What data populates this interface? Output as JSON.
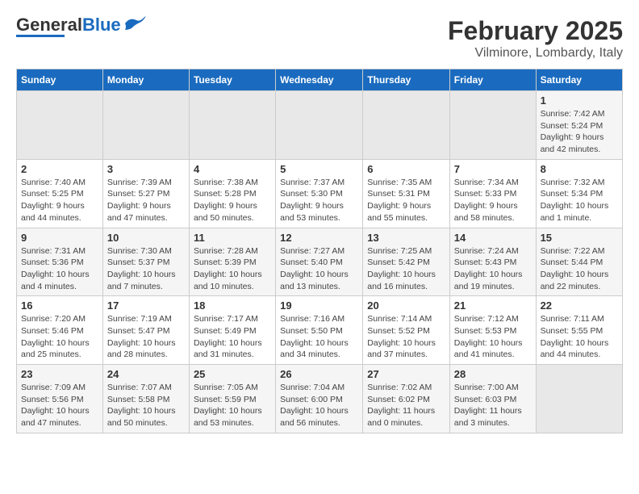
{
  "header": {
    "logo_general": "General",
    "logo_blue": "Blue",
    "title": "February 2025",
    "subtitle": "Vilminore, Lombardy, Italy"
  },
  "weekdays": [
    "Sunday",
    "Monday",
    "Tuesday",
    "Wednesday",
    "Thursday",
    "Friday",
    "Saturday"
  ],
  "weeks": [
    [
      {
        "day": "",
        "empty": true
      },
      {
        "day": "",
        "empty": true
      },
      {
        "day": "",
        "empty": true
      },
      {
        "day": "",
        "empty": true
      },
      {
        "day": "",
        "empty": true
      },
      {
        "day": "",
        "empty": true
      },
      {
        "day": "1",
        "sunrise": "Sunrise: 7:42 AM",
        "sunset": "Sunset: 5:24 PM",
        "daylight": "Daylight: 9 hours and 42 minutes."
      }
    ],
    [
      {
        "day": "2",
        "sunrise": "Sunrise: 7:40 AM",
        "sunset": "Sunset: 5:25 PM",
        "daylight": "Daylight: 9 hours and 44 minutes."
      },
      {
        "day": "3",
        "sunrise": "Sunrise: 7:39 AM",
        "sunset": "Sunset: 5:27 PM",
        "daylight": "Daylight: 9 hours and 47 minutes."
      },
      {
        "day": "4",
        "sunrise": "Sunrise: 7:38 AM",
        "sunset": "Sunset: 5:28 PM",
        "daylight": "Daylight: 9 hours and 50 minutes."
      },
      {
        "day": "5",
        "sunrise": "Sunrise: 7:37 AM",
        "sunset": "Sunset: 5:30 PM",
        "daylight": "Daylight: 9 hours and 53 minutes."
      },
      {
        "day": "6",
        "sunrise": "Sunrise: 7:35 AM",
        "sunset": "Sunset: 5:31 PM",
        "daylight": "Daylight: 9 hours and 55 minutes."
      },
      {
        "day": "7",
        "sunrise": "Sunrise: 7:34 AM",
        "sunset": "Sunset: 5:33 PM",
        "daylight": "Daylight: 9 hours and 58 minutes."
      },
      {
        "day": "8",
        "sunrise": "Sunrise: 7:32 AM",
        "sunset": "Sunset: 5:34 PM",
        "daylight": "Daylight: 10 hours and 1 minute."
      }
    ],
    [
      {
        "day": "9",
        "sunrise": "Sunrise: 7:31 AM",
        "sunset": "Sunset: 5:36 PM",
        "daylight": "Daylight: 10 hours and 4 minutes."
      },
      {
        "day": "10",
        "sunrise": "Sunrise: 7:30 AM",
        "sunset": "Sunset: 5:37 PM",
        "daylight": "Daylight: 10 hours and 7 minutes."
      },
      {
        "day": "11",
        "sunrise": "Sunrise: 7:28 AM",
        "sunset": "Sunset: 5:39 PM",
        "daylight": "Daylight: 10 hours and 10 minutes."
      },
      {
        "day": "12",
        "sunrise": "Sunrise: 7:27 AM",
        "sunset": "Sunset: 5:40 PM",
        "daylight": "Daylight: 10 hours and 13 minutes."
      },
      {
        "day": "13",
        "sunrise": "Sunrise: 7:25 AM",
        "sunset": "Sunset: 5:42 PM",
        "daylight": "Daylight: 10 hours and 16 minutes."
      },
      {
        "day": "14",
        "sunrise": "Sunrise: 7:24 AM",
        "sunset": "Sunset: 5:43 PM",
        "daylight": "Daylight: 10 hours and 19 minutes."
      },
      {
        "day": "15",
        "sunrise": "Sunrise: 7:22 AM",
        "sunset": "Sunset: 5:44 PM",
        "daylight": "Daylight: 10 hours and 22 minutes."
      }
    ],
    [
      {
        "day": "16",
        "sunrise": "Sunrise: 7:20 AM",
        "sunset": "Sunset: 5:46 PM",
        "daylight": "Daylight: 10 hours and 25 minutes."
      },
      {
        "day": "17",
        "sunrise": "Sunrise: 7:19 AM",
        "sunset": "Sunset: 5:47 PM",
        "daylight": "Daylight: 10 hours and 28 minutes."
      },
      {
        "day": "18",
        "sunrise": "Sunrise: 7:17 AM",
        "sunset": "Sunset: 5:49 PM",
        "daylight": "Daylight: 10 hours and 31 minutes."
      },
      {
        "day": "19",
        "sunrise": "Sunrise: 7:16 AM",
        "sunset": "Sunset: 5:50 PM",
        "daylight": "Daylight: 10 hours and 34 minutes."
      },
      {
        "day": "20",
        "sunrise": "Sunrise: 7:14 AM",
        "sunset": "Sunset: 5:52 PM",
        "daylight": "Daylight: 10 hours and 37 minutes."
      },
      {
        "day": "21",
        "sunrise": "Sunrise: 7:12 AM",
        "sunset": "Sunset: 5:53 PM",
        "daylight": "Daylight: 10 hours and 41 minutes."
      },
      {
        "day": "22",
        "sunrise": "Sunrise: 7:11 AM",
        "sunset": "Sunset: 5:55 PM",
        "daylight": "Daylight: 10 hours and 44 minutes."
      }
    ],
    [
      {
        "day": "23",
        "sunrise": "Sunrise: 7:09 AM",
        "sunset": "Sunset: 5:56 PM",
        "daylight": "Daylight: 10 hours and 47 minutes."
      },
      {
        "day": "24",
        "sunrise": "Sunrise: 7:07 AM",
        "sunset": "Sunset: 5:58 PM",
        "daylight": "Daylight: 10 hours and 50 minutes."
      },
      {
        "day": "25",
        "sunrise": "Sunrise: 7:05 AM",
        "sunset": "Sunset: 5:59 PM",
        "daylight": "Daylight: 10 hours and 53 minutes."
      },
      {
        "day": "26",
        "sunrise": "Sunrise: 7:04 AM",
        "sunset": "Sunset: 6:00 PM",
        "daylight": "Daylight: 10 hours and 56 minutes."
      },
      {
        "day": "27",
        "sunrise": "Sunrise: 7:02 AM",
        "sunset": "Sunset: 6:02 PM",
        "daylight": "Daylight: 11 hours and 0 minutes."
      },
      {
        "day": "28",
        "sunrise": "Sunrise: 7:00 AM",
        "sunset": "Sunset: 6:03 PM",
        "daylight": "Daylight: 11 hours and 3 minutes."
      },
      {
        "day": "",
        "empty": true
      }
    ]
  ]
}
